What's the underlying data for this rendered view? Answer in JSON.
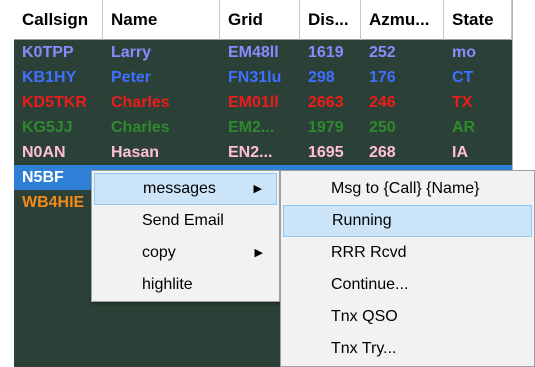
{
  "columns": [
    {
      "key": "callsign",
      "label": "Callsign"
    },
    {
      "key": "name",
      "label": "Name"
    },
    {
      "key": "grid",
      "label": "Grid"
    },
    {
      "key": "dist",
      "label": "Dis..."
    },
    {
      "key": "azm",
      "label": "Azmu..."
    },
    {
      "key": "state",
      "label": "State"
    }
  ],
  "rows": [
    {
      "callsign": "K0TPP",
      "name": "Larry",
      "grid": "EM48ll",
      "dist": "1619",
      "azm": "252",
      "state": "mo",
      "color": "#8a8aff"
    },
    {
      "callsign": "KB1HY",
      "name": "Peter",
      "grid": "FN31lu",
      "dist": "298",
      "azm": "176",
      "state": "CT",
      "color": "#3f6fff"
    },
    {
      "callsign": "KD5TKR",
      "name": "Charles",
      "grid": "EM01ll",
      "dist": "2663",
      "azm": "246",
      "state": "TX",
      "color": "#ee1b1b"
    },
    {
      "callsign": "KG5JJ",
      "name": "Charles",
      "grid": "EM2...",
      "dist": "1979",
      "azm": "250",
      "state": "AR",
      "color": "#2f8a2f"
    },
    {
      "callsign": "N0AN",
      "name": "Hasan",
      "grid": "EN2...",
      "dist": "1695",
      "azm": "268",
      "state": "IA",
      "color": "#ffc0d4"
    },
    {
      "callsign": "N5BF",
      "name": "",
      "grid": "",
      "dist": "",
      "azm": "",
      "state": "",
      "color": "#ffffff",
      "selected": true
    },
    {
      "callsign": "WB4HIE",
      "name": "",
      "grid": "",
      "dist": "",
      "azm": "",
      "state": "",
      "color": "#f08a1a"
    }
  ],
  "context_menu": {
    "items": [
      {
        "label": "messages",
        "has_submenu": true,
        "highlighted": true
      },
      {
        "label": "Send Email",
        "has_submenu": false
      },
      {
        "label": "copy",
        "has_submenu": true
      },
      {
        "label": "highlite",
        "has_submenu": false
      }
    ]
  },
  "submenu": {
    "items": [
      {
        "label": "Msg to {Call} {Name}"
      },
      {
        "label": "Running",
        "highlighted": true
      },
      {
        "label": "RRR Rcvd"
      },
      {
        "label": "Continue..."
      },
      {
        "label": "Tnx QSO"
      },
      {
        "label": "Tnx Try..."
      }
    ]
  },
  "icons": {
    "submenu_arrow": "chevron-right-icon"
  }
}
